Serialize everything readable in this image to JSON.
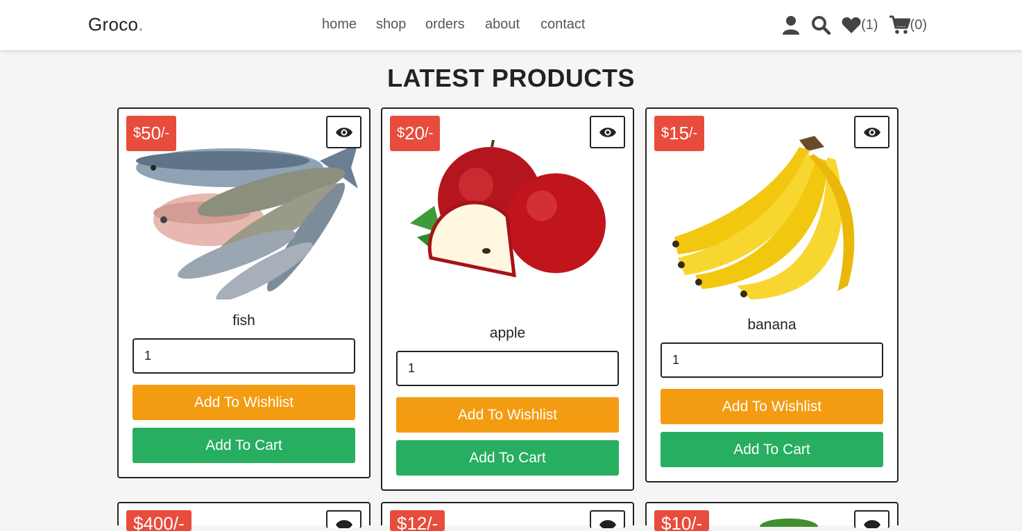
{
  "brand": {
    "name": "Groco",
    "dot": "."
  },
  "nav": [
    "home",
    "shop",
    "orders",
    "about",
    "contact"
  ],
  "header_icons": {
    "user": "user-icon",
    "search": "search-icon",
    "wishlist": {
      "icon": "heart-icon",
      "count": "(1)"
    },
    "cart": {
      "icon": "cart-icon",
      "count": "(0)"
    }
  },
  "heading": "LATEST PRODUCTS",
  "colors": {
    "price_bg": "#e74c3c",
    "wishlist_btn": "#f39c12",
    "cart_btn": "#27ae60",
    "accent": "#27ae60"
  },
  "products": [
    {
      "currency": "$",
      "price": "50",
      "suffix": "/-",
      "name": "fish",
      "qty": "1",
      "wishlist_label": "Add To Wishlist",
      "cart_label": "Add To Cart"
    },
    {
      "currency": "$",
      "price": "20",
      "suffix": "/-",
      "name": "apple",
      "qty": "1",
      "wishlist_label": "Add To Wishlist",
      "cart_label": "Add To Cart"
    },
    {
      "currency": "$",
      "price": "15",
      "suffix": "/-",
      "name": "banana",
      "qty": "1",
      "wishlist_label": "Add To Wishlist",
      "cart_label": "Add To Cart"
    }
  ],
  "second_row_prices": [
    "$400/-",
    "$12/-",
    "$10/-"
  ]
}
